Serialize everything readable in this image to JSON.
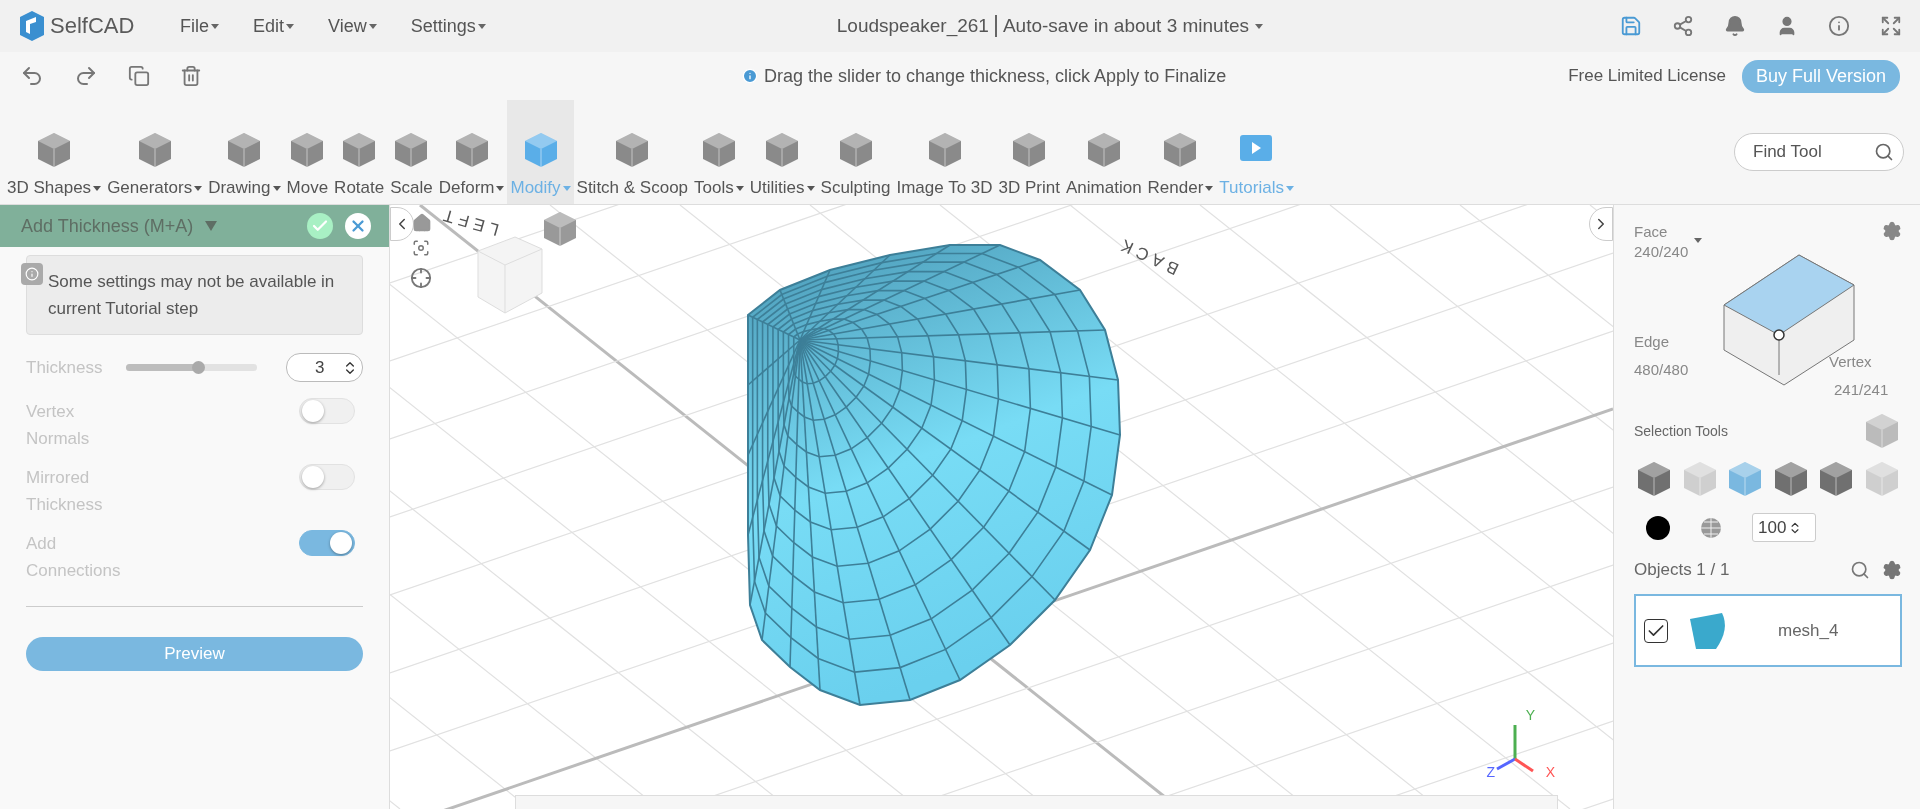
{
  "app": {
    "logo": "SelfCAD",
    "menus": [
      {
        "label": "File"
      },
      {
        "label": "Edit"
      },
      {
        "label": "View"
      },
      {
        "label": "Settings"
      }
    ],
    "document_title": "Loudspeaker_261",
    "autosave": "Auto-save in about 3 minutes"
  },
  "action_bar": {
    "hint": "Drag the slider to change thickness, click Apply to Finalize",
    "license": "Free Limited License",
    "buy_button": "Buy Full Version"
  },
  "toolbar": {
    "tools": [
      {
        "label": "3D Shapes",
        "dropdown": true,
        "selected": false,
        "kind": "tool"
      },
      {
        "label": "Generators",
        "dropdown": true,
        "selected": false,
        "kind": "tool"
      },
      {
        "label": "Drawing",
        "dropdown": true,
        "selected": false,
        "kind": "tool"
      },
      {
        "label": "Move",
        "dropdown": false,
        "selected": false,
        "kind": "tool"
      },
      {
        "label": "Rotate",
        "dropdown": false,
        "selected": false,
        "kind": "tool"
      },
      {
        "label": "Scale",
        "dropdown": false,
        "selected": false,
        "kind": "tool"
      },
      {
        "label": "Deform",
        "dropdown": true,
        "selected": false,
        "kind": "tool"
      },
      {
        "label": "Modify",
        "dropdown": true,
        "selected": true,
        "kind": "tool"
      },
      {
        "label": "Stitch & Scoop",
        "dropdown": false,
        "selected": false,
        "kind": "tool"
      },
      {
        "label": "Tools",
        "dropdown": true,
        "selected": false,
        "kind": "tool"
      },
      {
        "label": "Utilities",
        "dropdown": true,
        "selected": false,
        "kind": "tool"
      },
      {
        "label": "Sculpting",
        "dropdown": false,
        "selected": false,
        "kind": "tool"
      },
      {
        "label": "Image To 3D",
        "dropdown": false,
        "selected": false,
        "kind": "tool"
      },
      {
        "label": "3D Print",
        "dropdown": false,
        "selected": false,
        "kind": "tool"
      },
      {
        "label": "Animation",
        "dropdown": false,
        "selected": false,
        "kind": "tool"
      },
      {
        "label": "Render",
        "dropdown": true,
        "selected": false,
        "kind": "tool"
      },
      {
        "label": "Tutorials",
        "dropdown": true,
        "selected": false,
        "kind": "tutorial"
      }
    ],
    "search": {
      "placeholder": "Find Tool"
    }
  },
  "tool_panel": {
    "title": "Add Thickness (M+A)",
    "notice": "Some settings may not be available in current Tutorial step",
    "thickness": {
      "label": "Thickness",
      "level": 0.55,
      "value": "3"
    },
    "toggles": [
      {
        "label": "Vertex Normals",
        "on": false
      },
      {
        "label": "Mirrored Thickness",
        "on": false
      },
      {
        "label": "Add Connections",
        "on": true
      }
    ],
    "preview_button": "Preview"
  },
  "viewport": {
    "scene_labels": [
      "LEFT",
      "BACK"
    ],
    "axes": [
      "Y",
      "Z",
      "X"
    ]
  },
  "selection_panel": {
    "face": {
      "label": "Face",
      "count": "240/240"
    },
    "edge": {
      "label": "Edge",
      "count": "480/480"
    },
    "vertex": {
      "label": "Vertex",
      "count": "241/241"
    },
    "selection_tools_label": "Selection Tools",
    "opacity": "100",
    "objects_label": "Objects 1 / 1",
    "objects": [
      {
        "name": "mesh_4",
        "checked": true,
        "selected": true
      }
    ]
  }
}
